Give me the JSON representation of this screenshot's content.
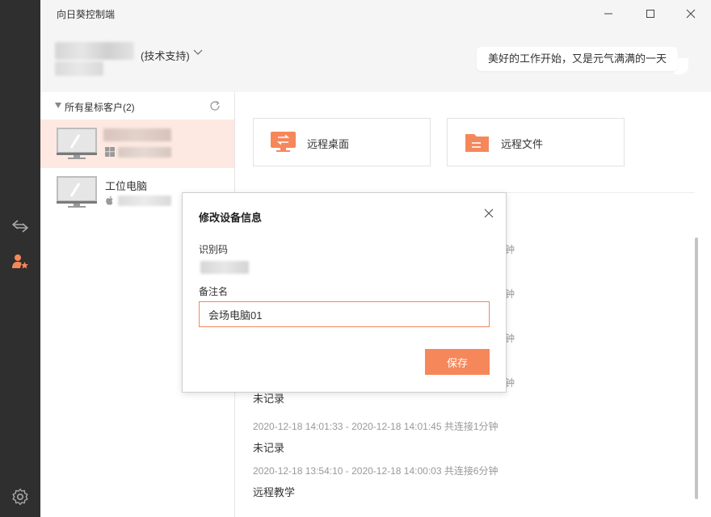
{
  "window": {
    "title": "向日葵控制端"
  },
  "nav": {
    "icons": [
      "swap-arrows-icon",
      "contacts-star-icon",
      "settings-gear-icon"
    ]
  },
  "user": {
    "role": "(技术支持)"
  },
  "greeting": "美好的工作开始，又是元气满满的一天",
  "sidebar": {
    "group_title": "所有星标客户(2)",
    "devices": [
      {
        "name": "",
        "os": "windows",
        "selected": true
      },
      {
        "name": "工位电脑",
        "os": "apple",
        "selected": false
      }
    ]
  },
  "actions": [
    {
      "label": "远程桌面",
      "icon": "remote-desktop-icon"
    },
    {
      "label": "远程文件",
      "icon": "remote-file-folder-icon"
    }
  ],
  "history": [
    {
      "time": "",
      "note": "未记录"
    },
    {
      "time": "2020-12-18 14:01:33 - 2020-12-18 14:01:45 共连接1分钟",
      "note": "未记录"
    },
    {
      "time": "2020-12-18 13:54:10 - 2020-12-18 14:00:03 共连接6分钟",
      "note": "远程教学"
    }
  ],
  "history_fragment": "钟",
  "dialog": {
    "title": "修改设备信息",
    "id_label": "识别码",
    "remark_label": "备注名",
    "remark_value": "会场电脑01",
    "save_label": "保存"
  },
  "colors": {
    "accent": "#f6875a",
    "sidebar_bg": "#2f2f2f",
    "selected_bg": "#fde9e1"
  }
}
